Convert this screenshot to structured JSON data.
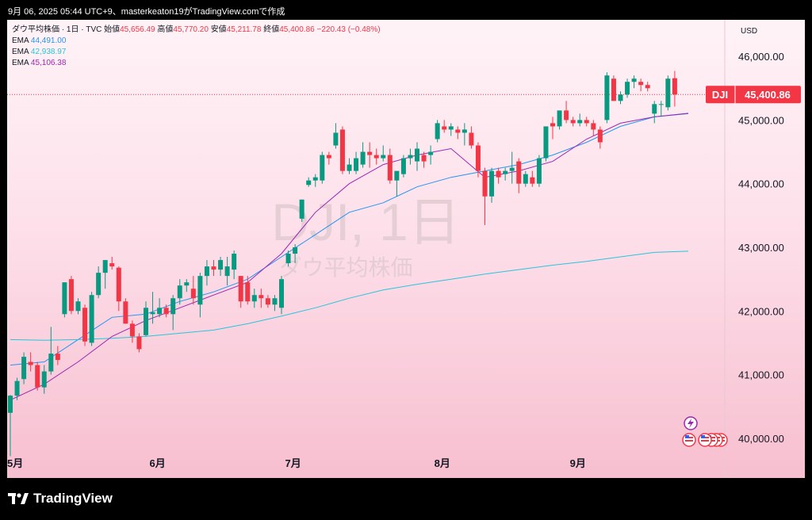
{
  "header": {
    "caption": "9月 06, 2025 05:44 UTC+9、masterkeaton19がTradingView.comで作成"
  },
  "legend": {
    "symbol_line": "ダウ平均株価 · 1日 · TVC",
    "open_label": "始値",
    "open": "45,656.49",
    "high_label": "高値",
    "high": "45,770.20",
    "low_label": "安値",
    "low": "45,211.78",
    "close_label": "終値",
    "close": "45,400.86",
    "change": "−220.43 (−0.48%)",
    "ema": [
      {
        "label": "EMA",
        "value": "44,491.00",
        "color": "#2196f3"
      },
      {
        "label": "EMA",
        "value": "42,938.97",
        "color": "#26c6da"
      },
      {
        "label": "EMA",
        "value": "45,106.38",
        "color": "#9c27b0"
      }
    ]
  },
  "watermark": {
    "title": "DJI, 1日",
    "subtitle": "ダウ平均株価"
  },
  "price_scale": {
    "currency": "USD",
    "ticks": [
      "46,000.00",
      "45,000.00",
      "44,000.00",
      "43,000.00",
      "42,000.00",
      "41,000.00",
      "40,000.00"
    ]
  },
  "price_tag": {
    "symbol": "DJI",
    "value": "45,400.86"
  },
  "months": [
    {
      "label": "5月",
      "day": 0
    },
    {
      "label": "6月",
      "day": 21
    },
    {
      "label": "7月",
      "day": 41
    },
    {
      "label": "8月",
      "day": 63
    },
    {
      "label": "9月",
      "day": 83
    }
  ],
  "footer": {
    "brand": "TradingView"
  },
  "colors": {
    "up": "#089981",
    "down": "#f23645"
  },
  "chart_data": {
    "type": "candlestick",
    "interval": "1D",
    "ylim": [
      39700,
      46300
    ],
    "ticks": [
      40000,
      41000,
      42000,
      43000,
      44000,
      45000,
      46000
    ],
    "last_price": 45400.86,
    "candles": [
      [
        40400,
        40680,
        39720,
        40670
      ],
      [
        40670,
        40950,
        40600,
        40900
      ],
      [
        40930,
        41350,
        40850,
        41280
      ],
      [
        41200,
        41350,
        41050,
        41150
      ],
      [
        41150,
        41200,
        40750,
        40800
      ],
      [
        40800,
        41150,
        40700,
        41050
      ],
      [
        41050,
        41750,
        41000,
        41330
      ],
      [
        41330,
        41450,
        41150,
        41230
      ],
      [
        41950,
        42450,
        41900,
        42450
      ],
      [
        42500,
        42550,
        41950,
        42000
      ],
      [
        42000,
        42200,
        41950,
        42150
      ],
      [
        42050,
        42100,
        41450,
        41520
      ],
      [
        41500,
        42300,
        41450,
        42250
      ],
      [
        42250,
        42700,
        42200,
        42600
      ],
      [
        42600,
        42750,
        42350,
        42800
      ],
      [
        42750,
        42850,
        42650,
        42700
      ],
      [
        42680,
        42700,
        42000,
        42150
      ],
      [
        42150,
        42200,
        41800,
        41800
      ],
      [
        41800,
        41850,
        41500,
        41600
      ],
      [
        41600,
        41650,
        41350,
        41400
      ],
      [
        41620,
        42150,
        41600,
        42050
      ],
      [
        41950,
        42300,
        41800,
        41980
      ],
      [
        41950,
        42200,
        41900,
        42050
      ],
      [
        42050,
        42100,
        41900,
        41950
      ],
      [
        41950,
        42250,
        41700,
        42200
      ],
      [
        42200,
        42500,
        42100,
        42400
      ],
      [
        42400,
        42500,
        42300,
        42450
      ],
      [
        42350,
        42550,
        42100,
        42200
      ],
      [
        42100,
        42600,
        41900,
        42550
      ],
      [
        42550,
        42800,
        42400,
        42700
      ],
      [
        42700,
        42800,
        42550,
        42650
      ],
      [
        42650,
        42850,
        42550,
        42800
      ],
      [
        42550,
        42850,
        42400,
        42700
      ],
      [
        42650,
        42950,
        42500,
        42900
      ],
      [
        42550,
        42550,
        42050,
        42150
      ],
      [
        42450,
        42550,
        42100,
        42150
      ],
      [
        42150,
        42350,
        42050,
        42250
      ],
      [
        42250,
        42350,
        42050,
        42200
      ],
      [
        42200,
        42250,
        42050,
        42100
      ],
      [
        42100,
        42250,
        42000,
        42200
      ],
      [
        42050,
        42550,
        41950,
        42500
      ],
      [
        42750,
        42950,
        42700,
        42900
      ],
      [
        42900,
        43050,
        42750,
        43000
      ],
      [
        43450,
        43750,
        43400,
        43750
      ],
      [
        43980,
        44100,
        43950,
        44050
      ],
      [
        44050,
        44150,
        43950,
        44100
      ],
      [
        44050,
        44500,
        44000,
        44450
      ],
      [
        44450,
        44500,
        44300,
        44400
      ],
      [
        44600,
        44950,
        44550,
        44800
      ],
      [
        44850,
        44900,
        44150,
        44200
      ],
      [
        44200,
        44400,
        44150,
        44300
      ],
      [
        44200,
        44500,
        44150,
        44400
      ],
      [
        44300,
        44650,
        44250,
        44500
      ],
      [
        44500,
        44650,
        44250,
        44450
      ],
      [
        44450,
        44550,
        44300,
        44400
      ],
      [
        44400,
        44600,
        44350,
        44450
      ],
      [
        44450,
        44550,
        44000,
        44050
      ],
      [
        44050,
        44150,
        43800,
        44200
      ],
      [
        44150,
        44450,
        44100,
        44400
      ],
      [
        44400,
        44550,
        44300,
        44450
      ],
      [
        44350,
        44650,
        44200,
        44550
      ],
      [
        44450,
        44500,
        44250,
        44350
      ],
      [
        44450,
        44600,
        44300,
        44500
      ],
      [
        44700,
        45000,
        44650,
        44950
      ],
      [
        44900,
        45000,
        44800,
        44850
      ],
      [
        44850,
        44950,
        44750,
        44900
      ],
      [
        44850,
        44900,
        44700,
        44800
      ],
      [
        44800,
        44950,
        44600,
        44850
      ],
      [
        44800,
        44900,
        44550,
        44600
      ],
      [
        44600,
        44650,
        44100,
        44200
      ],
      [
        44200,
        44250,
        43350,
        43800
      ],
      [
        43800,
        44250,
        43700,
        44200
      ],
      [
        44200,
        44250,
        44000,
        44100
      ],
      [
        44150,
        44250,
        44050,
        44200
      ],
      [
        44200,
        44500,
        44000,
        44250
      ],
      [
        44350,
        44400,
        43850,
        44000
      ],
      [
        44000,
        44200,
        43950,
        44150
      ],
      [
        44100,
        44200,
        43950,
        44000
      ],
      [
        44000,
        44450,
        43950,
        44400
      ],
      [
        44400,
        44450,
        44350,
        44900
      ],
      [
        44950,
        45050,
        44700,
        44900
      ],
      [
        44900,
        45000,
        44850,
        45150
      ],
      [
        45150,
        45300,
        44950,
        45000
      ],
      [
        45000,
        45050,
        44900,
        44950
      ],
      [
        44950,
        45100,
        44900,
        45000
      ],
      [
        45000,
        45050,
        44900,
        44950
      ],
      [
        44950,
        45000,
        44750,
        44850
      ],
      [
        44850,
        44900,
        44550,
        44650
      ],
      [
        45000,
        45750,
        44950,
        45700
      ],
      [
        45650,
        45700,
        45300,
        45300
      ],
      [
        45300,
        45450,
        45250,
        45400
      ],
      [
        45400,
        45650,
        45350,
        45600
      ],
      [
        45600,
        45700,
        45500,
        45650
      ],
      [
        45600,
        45650,
        45450,
        45550
      ],
      [
        45550,
        45600,
        45450,
        45500
      ],
      [
        45100,
        45300,
        44950,
        45250
      ],
      [
        45250,
        45300,
        45050,
        45250
      ],
      [
        45200,
        45700,
        45150,
        45650
      ],
      [
        45656.49,
        45770.2,
        45211.78,
        45400.86
      ]
    ],
    "series": [
      {
        "name": "EMA 44,491.00",
        "color": "#2196f3",
        "points": [
          [
            0,
            41150
          ],
          [
            5,
            41200
          ],
          [
            10,
            41550
          ],
          [
            15,
            41900
          ],
          [
            20,
            41950
          ],
          [
            25,
            42150
          ],
          [
            30,
            42300
          ],
          [
            35,
            42500
          ],
          [
            40,
            42850
          ],
          [
            45,
            43200
          ],
          [
            50,
            43550
          ],
          [
            55,
            43700
          ],
          [
            60,
            43950
          ],
          [
            65,
            44100
          ],
          [
            70,
            44200
          ],
          [
            75,
            44300
          ],
          [
            80,
            44450
          ],
          [
            85,
            44650
          ],
          [
            90,
            44900
          ],
          [
            95,
            45050
          ],
          [
            100,
            45100
          ]
        ]
      },
      {
        "name": "EMA 42,938.97",
        "color": "#26c6da",
        "points": [
          [
            0,
            41550
          ],
          [
            5,
            41540
          ],
          [
            10,
            41550
          ],
          [
            15,
            41570
          ],
          [
            20,
            41600
          ],
          [
            25,
            41650
          ],
          [
            30,
            41700
          ],
          [
            35,
            41800
          ],
          [
            40,
            41920
          ],
          [
            45,
            42050
          ],
          [
            50,
            42200
          ],
          [
            55,
            42330
          ],
          [
            60,
            42420
          ],
          [
            65,
            42500
          ],
          [
            70,
            42580
          ],
          [
            75,
            42650
          ],
          [
            80,
            42720
          ],
          [
            85,
            42780
          ],
          [
            90,
            42850
          ],
          [
            95,
            42920
          ],
          [
            100,
            42938.97
          ]
        ]
      },
      {
        "name": "EMA 45,106.38",
        "color": "#9c27b0",
        "points": [
          [
            0,
            40600
          ],
          [
            5,
            40850
          ],
          [
            10,
            41200
          ],
          [
            15,
            41600
          ],
          [
            20,
            41850
          ],
          [
            25,
            42050
          ],
          [
            30,
            42250
          ],
          [
            35,
            42450
          ],
          [
            40,
            42900
          ],
          [
            45,
            43550
          ],
          [
            50,
            44000
          ],
          [
            55,
            44300
          ],
          [
            60,
            44450
          ],
          [
            65,
            44550
          ],
          [
            70,
            44100
          ],
          [
            75,
            44200
          ],
          [
            80,
            44350
          ],
          [
            85,
            44700
          ],
          [
            90,
            44950
          ],
          [
            95,
            45050
          ],
          [
            100,
            45106.38
          ]
        ]
      }
    ]
  }
}
